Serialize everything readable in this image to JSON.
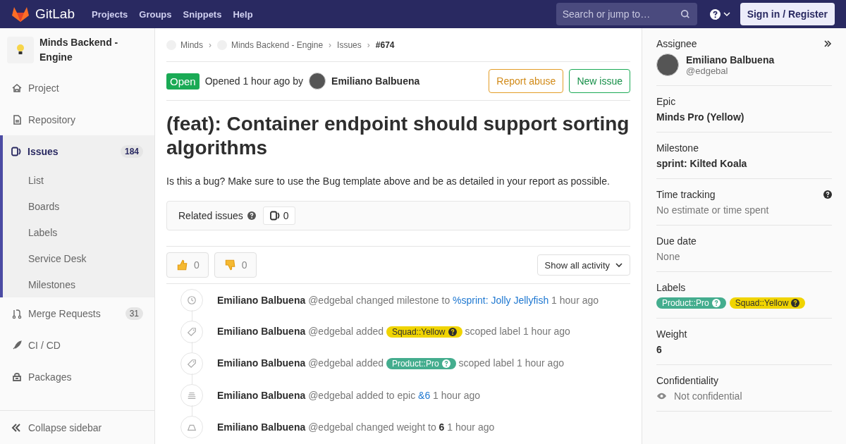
{
  "topbar": {
    "brand": "GitLab",
    "nav": [
      "Projects",
      "Groups",
      "Snippets",
      "Help"
    ],
    "search": {
      "placeholder": "Search or jump to…"
    },
    "signin": "Sign in / Register"
  },
  "sidebar": {
    "project": "Minds Backend - Engine",
    "items": [
      {
        "label": "Project",
        "selected": false
      },
      {
        "label": "Repository",
        "selected": false
      },
      {
        "label": "Issues",
        "selected": true,
        "count": "184",
        "children": [
          {
            "label": "List"
          },
          {
            "label": "Boards"
          },
          {
            "label": "Labels"
          },
          {
            "label": "Service Desk"
          },
          {
            "label": "Milestones"
          }
        ]
      },
      {
        "label": "Merge Requests",
        "selected": false,
        "count": "31"
      },
      {
        "label": "CI / CD",
        "selected": false
      },
      {
        "label": "Packages",
        "selected": false
      }
    ],
    "collapse": "Collapse sidebar"
  },
  "breadcrumbs": [
    {
      "kind": "project",
      "label": "Minds"
    },
    {
      "kind": "separator",
      "label": "›"
    },
    {
      "kind": "project",
      "label": "Minds Backend - Engine"
    },
    {
      "kind": "separator",
      "label": "›"
    },
    {
      "kind": "link",
      "label": "Issues"
    },
    {
      "kind": "separator",
      "label": "›"
    },
    {
      "kind": "current",
      "label": "#674"
    }
  ],
  "issue": {
    "status": "Open",
    "opened": "Opened 1 hour ago by",
    "author": "Emiliano Balbuena",
    "buttons": [
      {
        "label": "Report abuse",
        "kind": "warning"
      },
      {
        "label": "New issue",
        "kind": "success"
      }
    ],
    "title": "(feat): Container endpoint should support sorting algorithms",
    "description": "Is this a bug? Make sure to use the Bug template above and be as detailed in your report as possible.",
    "related": {
      "label": "Related issues",
      "count": "0"
    },
    "reactions": [
      {
        "kind": "up",
        "count": "0"
      },
      {
        "kind": "down",
        "count": "0"
      }
    ],
    "activity_filter": "Show all activity"
  },
  "activity": [
    {
      "author": "Emiliano Balbuena",
      "handle": "@edgebal",
      "parts": [
        {
          "kind": "text",
          "text": "changed milestone to"
        },
        {
          "kind": "link",
          "text": "%sprint: Jolly Jellyfish"
        },
        {
          "kind": "text",
          "text": "1 hour ago"
        }
      ]
    },
    {
      "author": "Emiliano Balbuena",
      "handle": "@edgebal",
      "parts": [
        {
          "kind": "text",
          "text": "added"
        },
        {
          "kind": "label",
          "text": "Squad::Yellow",
          "color": "#f0d400"
        },
        {
          "kind": "text",
          "text": "scoped label 1 hour ago"
        }
      ]
    },
    {
      "author": "Emiliano Balbuena",
      "handle": "@edgebal",
      "parts": [
        {
          "kind": "text",
          "text": "added"
        },
        {
          "kind": "label",
          "text": "Product::Pro",
          "color": "#44ad8e"
        },
        {
          "kind": "text",
          "text": "scoped label 1 hour ago"
        }
      ]
    },
    {
      "author": "Emiliano Balbuena",
      "handle": "@edgebal",
      "parts": [
        {
          "kind": "text",
          "text": "added to epic"
        },
        {
          "kind": "link",
          "text": "&6"
        },
        {
          "kind": "text",
          "text": "1 hour ago"
        }
      ]
    },
    {
      "author": "Emiliano Balbuena",
      "handle": "@edgebal",
      "parts": [
        {
          "kind": "text",
          "text": "changed weight to"
        },
        {
          "kind": "bold",
          "text": "6"
        },
        {
          "kind": "text",
          "text": "1 hour ago"
        }
      ]
    }
  ],
  "right_sidebar": [
    {
      "kind": "user",
      "title": "Assignee",
      "name": "Emiliano Balbuena",
      "handle": "@edgebal"
    },
    {
      "kind": "bold",
      "title": "Epic",
      "value": "Minds Pro (Yellow)"
    },
    {
      "kind": "bold",
      "title": "Milestone",
      "value": "sprint: Kilted Koala"
    },
    {
      "kind": "muted",
      "title": "Time tracking",
      "value": "No estimate or time spent",
      "help": true
    },
    {
      "kind": "muted",
      "title": "Due date",
      "value": "None"
    },
    {
      "kind": "labels",
      "title": "Labels",
      "labels": [
        {
          "text": "Product::Pro",
          "color": "#44ad8e"
        },
        {
          "text": "Squad::Yellow",
          "color": "#f0d400"
        }
      ]
    },
    {
      "kind": "bold",
      "title": "Weight",
      "value": "6"
    },
    {
      "kind": "eye",
      "title": "Confidentiality",
      "value": "Not confidential"
    }
  ]
}
